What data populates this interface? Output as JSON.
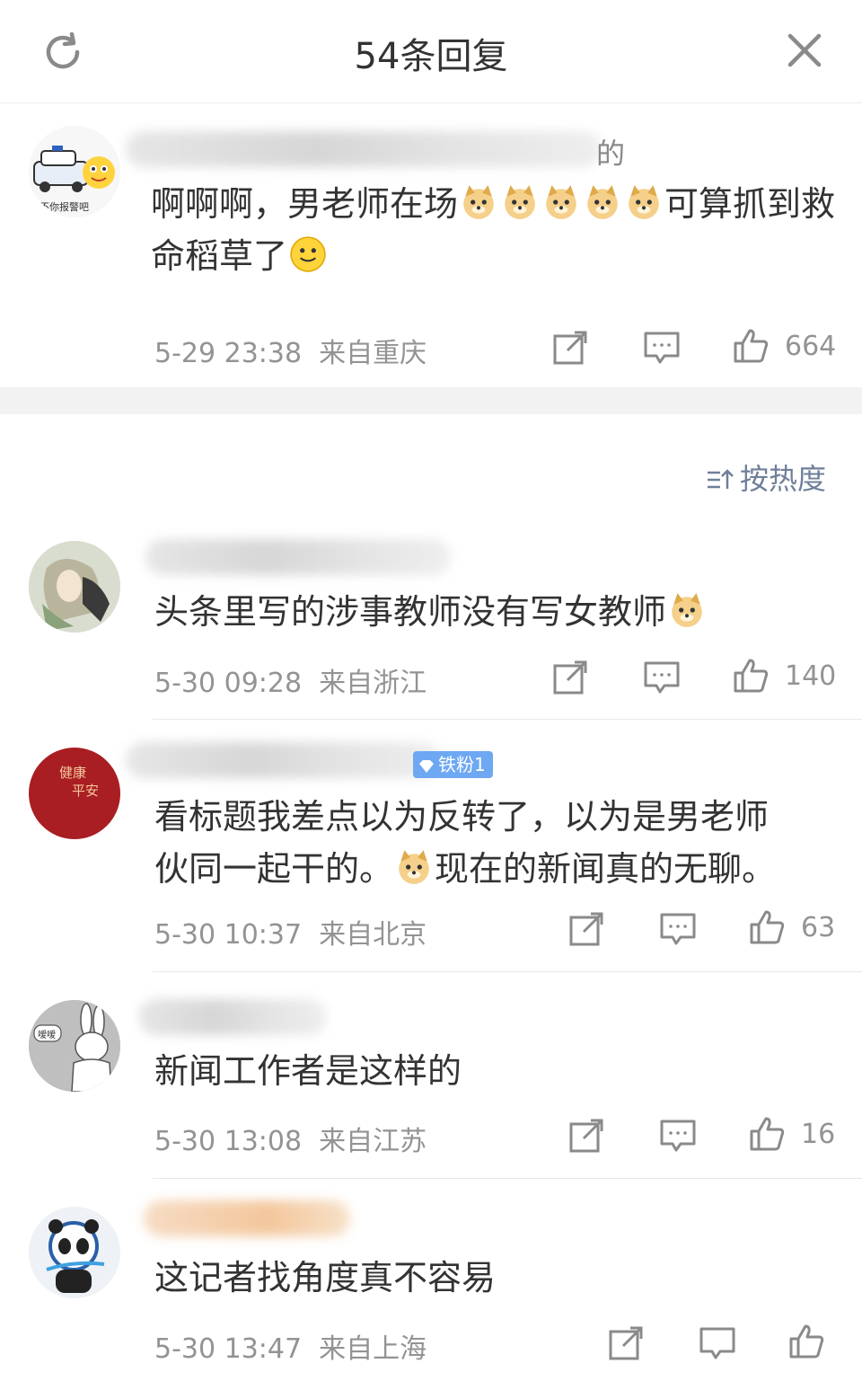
{
  "header": {
    "title": "54条回复"
  },
  "root_comment": {
    "avatar_text": "不你报警吧",
    "name_suffix": "的",
    "text_before": "啊啊啊，男老师在场",
    "text_after": "可算抓到救命稻草了",
    "time": "5-29 23:38  来自重庆",
    "likes": "664"
  },
  "sort": {
    "label": "按热度"
  },
  "replies": [
    {
      "name_suffix": "",
      "text": "头条里写的涉事教师没有写女教师",
      "time": "5-30 09:28  来自浙江",
      "likes": "140"
    },
    {
      "badge": "铁粉1",
      "avatar_lines": [
        "健康",
        "平安"
      ],
      "text_line1": "看标题我差点以为反转了，以为是男老师",
      "text_line2a": "伙同一起干的。",
      "text_line2b": "现在的新闻真的无聊。",
      "time": "5-30 10:37  来自北京",
      "likes": "63"
    },
    {
      "avatar_bubble": "嗳嗳",
      "text": "新闻工作者是这样的",
      "time": "5-30 13:08  来自江苏",
      "likes": "16"
    },
    {
      "text": "这记者找角度真不容易",
      "time": "5-30 13:47  来自上海"
    }
  ],
  "colors": {
    "meta": "#939393",
    "sort": "#6f7f99",
    "badge": "#6ea8f3",
    "gap": "#f2f2f2"
  }
}
